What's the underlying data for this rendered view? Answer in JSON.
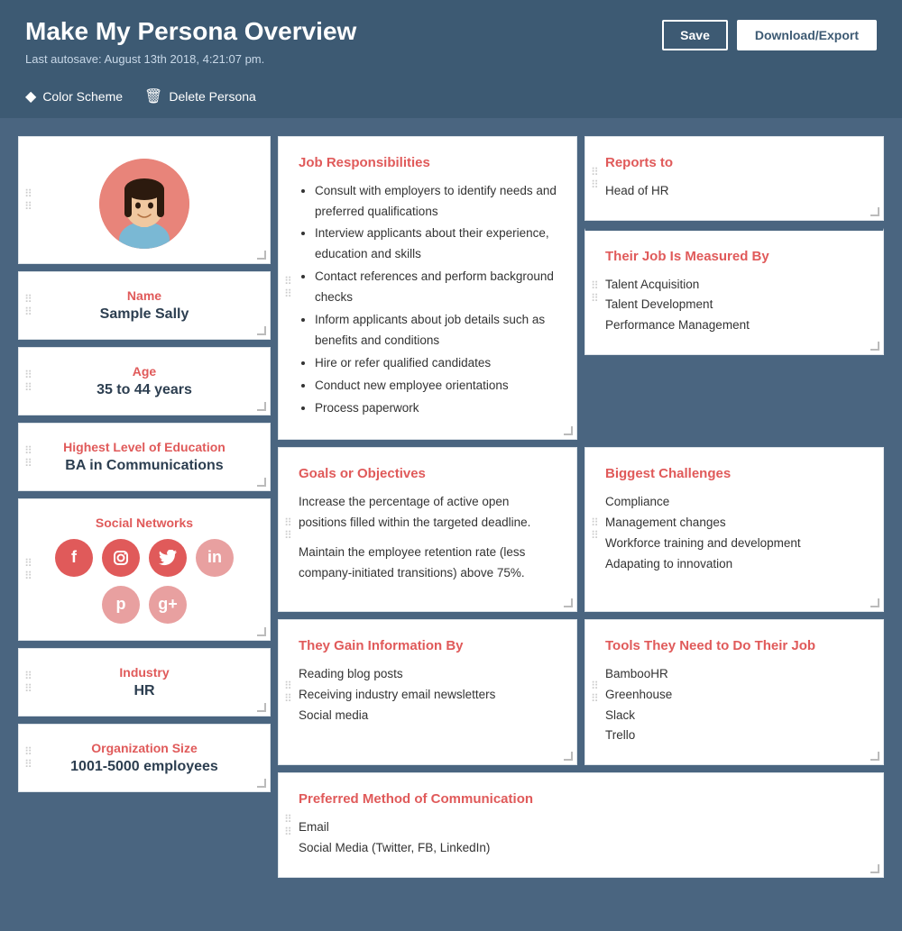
{
  "header": {
    "title": "Make My Persona Overview",
    "autosave": "Last autosave: August 13th 2018, 4:21:07 pm.",
    "toolbar": {
      "color_scheme": "Color Scheme",
      "delete_persona": "Delete Persona"
    },
    "buttons": {
      "save": "Save",
      "download": "Download/Export"
    }
  },
  "persona": {
    "avatar_alt": "Sample Sally avatar",
    "name_label": "Name",
    "name_value": "Sample Sally",
    "age_label": "Age",
    "age_value": "35 to 44 years",
    "education_label": "Highest Level of Education",
    "education_value": "BA in Communications",
    "social_label": "Social Networks",
    "industry_label": "Industry",
    "industry_value": "HR",
    "org_size_label": "Organization Size",
    "org_size_value": "1001-5000 employees"
  },
  "cards": {
    "job_responsibilities": {
      "title": "Job Responsibilities",
      "items": [
        "Consult with employers to identify needs and preferred qualifications",
        "Interview applicants about their experience, education and skills",
        "Contact references and perform background checks",
        "Inform applicants about job details such as benefits and conditions",
        "Hire or refer qualified candidates",
        "Conduct new employee orientations",
        "Process paperwork"
      ]
    },
    "reports_to": {
      "title": "Reports to",
      "value": "Head of HR"
    },
    "measured_by": {
      "title": "Their Job Is Measured By",
      "items": [
        "Talent Acquisition",
        "Talent Development",
        "Performance Management"
      ]
    },
    "goals": {
      "title": "Goals or Objectives",
      "paragraphs": [
        "Increase the percentage of active open positions filled within the targeted deadline.",
        "Maintain the employee retention rate (less company-initiated transitions) above 75%."
      ]
    },
    "challenges": {
      "title": "Biggest Challenges",
      "items": [
        "Compliance",
        "Management changes",
        "Workforce training and development",
        "Adapating to innovation"
      ]
    },
    "gain_info": {
      "title": "They Gain Information By",
      "items": [
        "Reading blog posts",
        "Receiving industry email newsletters",
        "Social media"
      ]
    },
    "tools": {
      "title": "Tools They Need to Do Their Job",
      "items": [
        "BambooHR",
        "Greenhouse",
        "Slack",
        "Trello"
      ]
    },
    "communication": {
      "title": "Preferred Method of Communication",
      "items": [
        "Email",
        "Social Media (Twitter, FB, LinkedIn)"
      ]
    }
  },
  "social_icons": [
    {
      "name": "Facebook",
      "symbol": "f",
      "row": 1
    },
    {
      "name": "Instagram",
      "symbol": "in",
      "row": 1
    },
    {
      "name": "Twitter",
      "symbol": "t",
      "row": 1
    },
    {
      "name": "LinkedIn",
      "symbol": "in",
      "row": 2
    },
    {
      "name": "Pinterest",
      "symbol": "p",
      "row": 2
    },
    {
      "name": "Google+",
      "symbol": "g+",
      "row": 2
    }
  ],
  "colors": {
    "accent": "#e05a5a",
    "header_bg": "#3d5a73",
    "bg": "#4a6580",
    "card_bg": "#ffffff"
  }
}
